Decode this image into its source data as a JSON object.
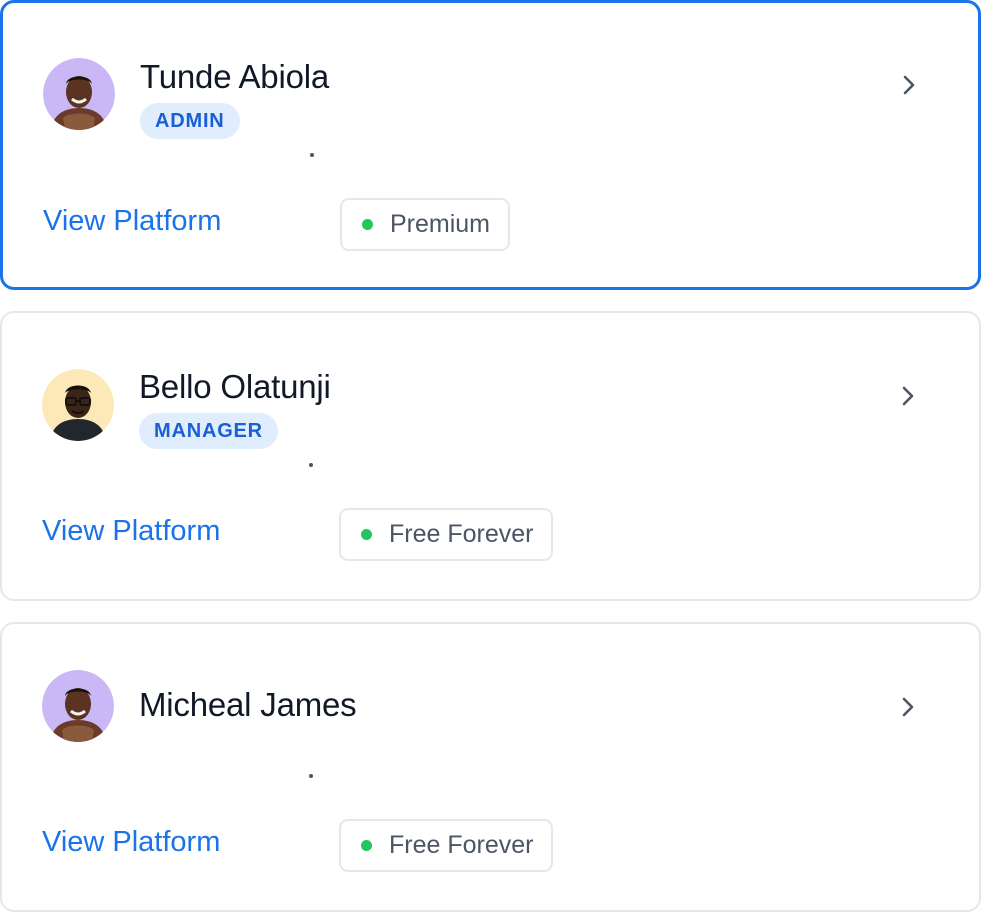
{
  "accent_color": "#1a73e8",
  "status_color": "#22c55e",
  "users": [
    {
      "name": "Tunde Abiola",
      "role": "ADMIN",
      "link_label": "View Platform",
      "plan": "Premium",
      "selected": true,
      "avatar_bg": "#c9b8f5",
      "avatar_icon": "user-avatar"
    },
    {
      "name": "Bello Olatunji",
      "role": "MANAGER",
      "link_label": "View Platform",
      "plan": "Free Forever",
      "selected": false,
      "avatar_bg": "#fde8b8",
      "avatar_icon": "user-avatar"
    },
    {
      "name": "Micheal James",
      "role": "",
      "link_label": "View Platform",
      "plan": "Free Forever",
      "selected": false,
      "avatar_bg": "#c9b8f5",
      "avatar_icon": "user-avatar"
    }
  ],
  "icons": {
    "chevron": "chevron-right-icon",
    "status": "green-dot"
  }
}
